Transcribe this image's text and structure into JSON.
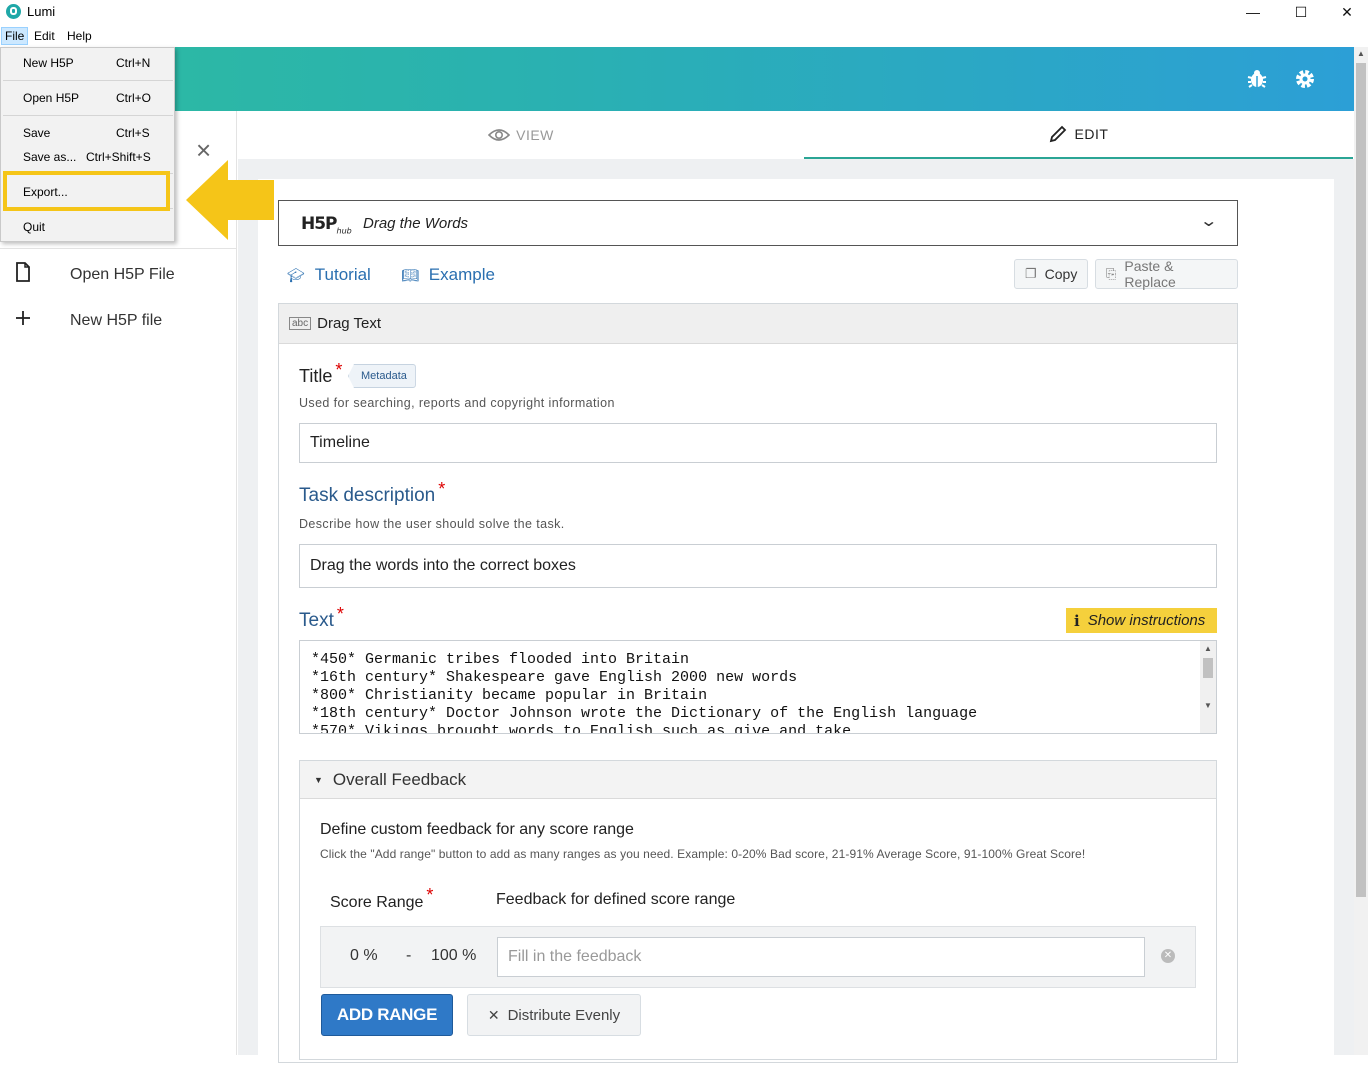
{
  "window": {
    "title": "Lumi",
    "minimize": "—",
    "maximize": "☐",
    "close": "✕"
  },
  "menubar": {
    "file": "File",
    "edit": "Edit",
    "help": "Help"
  },
  "file_menu": {
    "items": [
      {
        "label": "New H5P",
        "shortcut": "Ctrl+N"
      },
      {
        "label": "Open H5P",
        "shortcut": "Ctrl+O"
      },
      {
        "label": "Save",
        "shortcut": "Ctrl+S"
      },
      {
        "label": "Save as...",
        "shortcut": "Ctrl+Shift+S"
      },
      {
        "label": "Export...",
        "shortcut": ""
      },
      {
        "label": "Quit",
        "shortcut": ""
      }
    ],
    "highlighted": "Export..."
  },
  "header": {
    "bug_icon": "bug-icon",
    "settings_icon": "gear-icon"
  },
  "sidebar": {
    "items": [
      {
        "label": "Open H5P File",
        "icon": "file-icon"
      },
      {
        "label": "New H5P file",
        "icon": "plus-icon"
      }
    ]
  },
  "tabs": [
    {
      "label": "VIEW",
      "icon": "eye-icon",
      "active": false
    },
    {
      "label": "EDIT",
      "icon": "pencil-icon",
      "active": true
    }
  ],
  "hub": {
    "logo": "H5P",
    "logo_sub": "hub",
    "content_type": "Drag the Words"
  },
  "links": {
    "tutorial": "Tutorial",
    "example": "Example"
  },
  "actions": {
    "copy": "Copy",
    "paste_replace": "Paste & Replace"
  },
  "form": {
    "header": "Drag Text",
    "title_label": "Title",
    "metadata": "Metadata",
    "title_desc": "Used for searching, reports and copyright information",
    "title_value": "Timeline",
    "task_label": "Task description",
    "task_desc": "Describe how the user should solve the task.",
    "task_value": "Drag the words into the correct boxes",
    "text_label": "Text",
    "show_instructions": "Show instructions",
    "text_value": "*450* Germanic tribes flooded into Britain\n*16th century* Shakespeare gave English 2000 new words\n*800* Christianity became popular in Britain\n*18th century* Doctor Johnson wrote the Dictionary of the English language\n*570* Vikings brought words to English such as give and take",
    "required_mark": "*"
  },
  "feedback": {
    "section_label": "Overall Feedback",
    "heading": "Define custom feedback for any score range",
    "desc": "Click the \"Add range\" button to add as many ranges as you need. Example: 0-20% Bad score, 21-91% Average Score, 91-100% Great Score!",
    "score_range_label": "Score Range",
    "feedback_label": "Feedback for defined score range",
    "range_from": "0 %",
    "range_dash": "-",
    "range_to": "100 %",
    "feedback_placeholder": "Fill in the feedback",
    "add_range": "ADD RANGE",
    "distribute": "Distribute Evenly"
  },
  "colors": {
    "header_start": "#2dbba0",
    "header_end": "#2c9fd6",
    "accent_blue": "#2f79c7",
    "highlight_yellow": "#f5c518",
    "link_blue": "#2a6fb0"
  }
}
